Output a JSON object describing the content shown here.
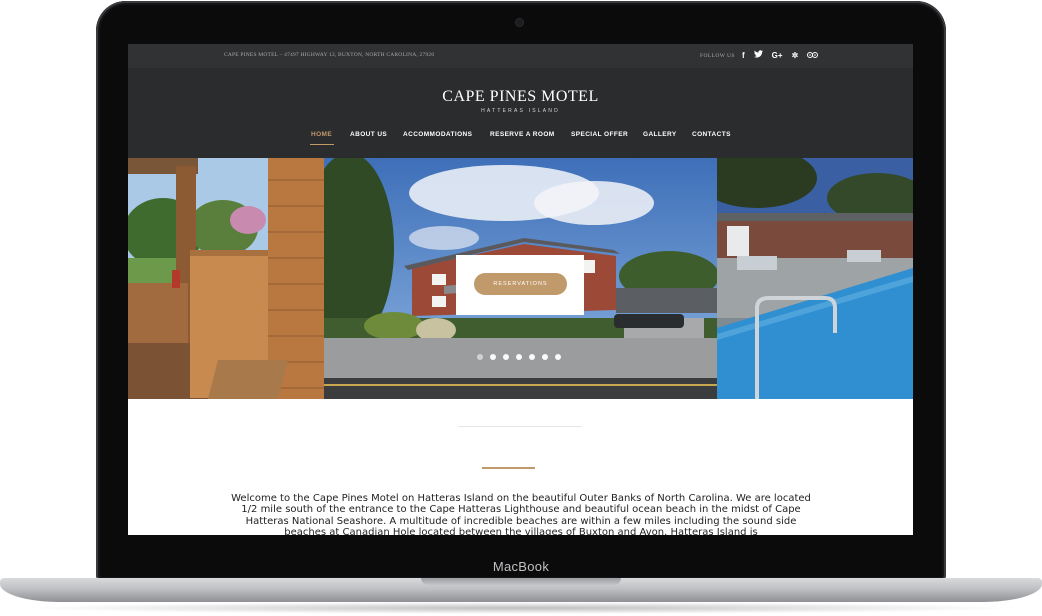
{
  "device": {
    "brand_label": "MacBook"
  },
  "topbar": {
    "address": "CAPE PINES MOTEL – 47497 HIGHWAY 12, BUXTON, NORTH CAROLINA, 27920",
    "follow_label": "FOLLOW US",
    "social_icons": [
      "facebook-icon",
      "twitter-icon",
      "google-plus-icon",
      "yelp-icon",
      "tripadvisor-icon"
    ]
  },
  "header": {
    "logo_title": "CAPE PINES MOTEL",
    "logo_subtitle": "HATTERAS ISLAND"
  },
  "nav": {
    "items": [
      {
        "label": "HOME",
        "active": true
      },
      {
        "label": "ABOUT US"
      },
      {
        "label": "ACCOMMODATIONS"
      },
      {
        "label": "RESERVE A ROOM"
      },
      {
        "label": "SPECIAL OFFER"
      },
      {
        "label": "GALLERY"
      },
      {
        "label": "CONTACTS"
      }
    ]
  },
  "hero": {
    "slides": [
      "wooden-porch-photo",
      "motel-building-photo",
      "pool-photo"
    ],
    "dot_count": 7,
    "active_dot": 1,
    "reserve_button": "RESERVATIONS"
  },
  "intro": {
    "text": "Welcome to the Cape Pines Motel on Hatteras Island on the beautiful Outer Banks of North Carolina. We are located 1/2 mile south of the entrance to the Cape Hatteras Lighthouse and beautiful ocean beach in the midst of Cape Hatteras National Seashore.  A multitude of incredible beaches are within a few miles including the sound side beaches at Canadian Hole located between the villages of Buxton and Avon.  Hatteras Island is"
  },
  "colors": {
    "accent": "#c19a6b",
    "topbar_bg": "#313234",
    "header_bg": "#2b2c2e"
  }
}
